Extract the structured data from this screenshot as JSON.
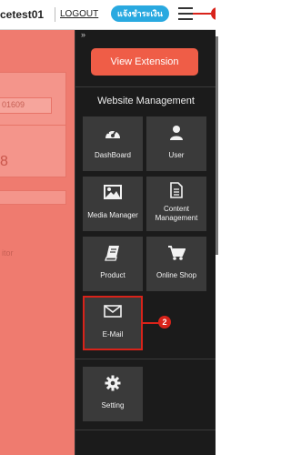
{
  "header": {
    "username": "cetest01",
    "logout_label": "LOGOUT",
    "notify_label": "แจ้งชำระเงิน"
  },
  "callouts": [
    "1",
    "2"
  ],
  "background": {
    "field_value": "01609",
    "big_number": "8",
    "text_fragment": "itor"
  },
  "panel": {
    "collapse_glyph": "»",
    "view_extension_label": "View Extension",
    "section_title": "Website Management",
    "tiles": [
      {
        "label": "DashBoard",
        "icon": "dashboard-icon"
      },
      {
        "label": "User",
        "icon": "user-icon"
      },
      {
        "label": "Media Manager",
        "icon": "image-icon"
      },
      {
        "label": "Content Management",
        "icon": "document-icon"
      },
      {
        "label": "Product",
        "icon": "book-icon"
      },
      {
        "label": "Online Shop",
        "icon": "cart-icon"
      },
      {
        "label": "E-Mail",
        "icon": "mail-icon"
      },
      {
        "label": "Setting",
        "icon": "gear-icon"
      }
    ]
  },
  "colors": {
    "accent": "#ef5d47",
    "panel_bg": "#1b1b1b",
    "tile_bg": "#3a3a3a",
    "callout": "#d8231a",
    "notify": "#29a9e0"
  }
}
